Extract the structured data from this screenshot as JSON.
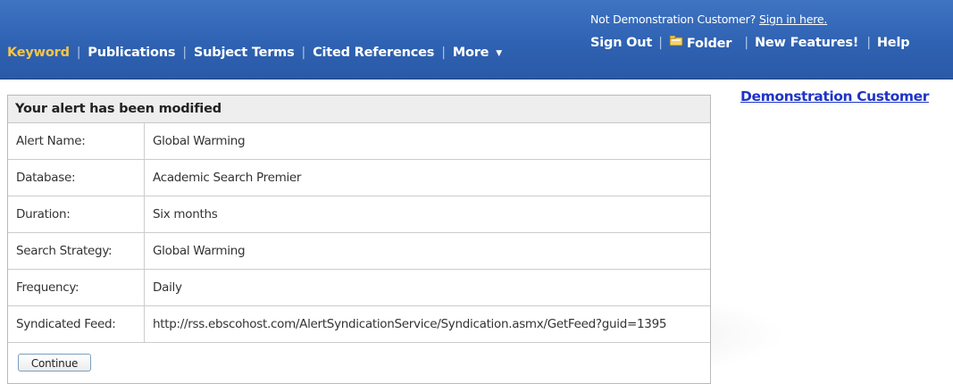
{
  "header": {
    "nav_tabs": [
      {
        "label": "Keyword",
        "active": true
      },
      {
        "label": "Publications",
        "active": false
      },
      {
        "label": "Subject Terms",
        "active": false
      },
      {
        "label": "Cited References",
        "active": false
      },
      {
        "label": "More",
        "active": false
      }
    ],
    "not_customer_text": "Not Demonstration Customer?",
    "sign_in_link": "Sign in here.",
    "utility_links": {
      "sign_out": "Sign Out",
      "folder": "Folder",
      "new_features": "New Features!",
      "help": "Help"
    },
    "colors": {
      "bar": "#2f62b2",
      "active_tab": "#f3c64b"
    }
  },
  "customer_link": "Demonstration Customer",
  "alert_panel": {
    "title": "Your alert has been modified",
    "rows": [
      {
        "label": "Alert Name:",
        "value": "Global Warming"
      },
      {
        "label": "Database:",
        "value": "Academic Search Premier"
      },
      {
        "label": "Duration:",
        "value": "Six months"
      },
      {
        "label": "Search Strategy:",
        "value": "Global Warming"
      },
      {
        "label": "Frequency:",
        "value": "Daily"
      },
      {
        "label": "Syndicated Feed:",
        "value": "http://rss.ebscohost.com/AlertSyndicationService/Syndication.asmx/GetFeed?guid=1395"
      }
    ],
    "continue_label": "Continue"
  }
}
